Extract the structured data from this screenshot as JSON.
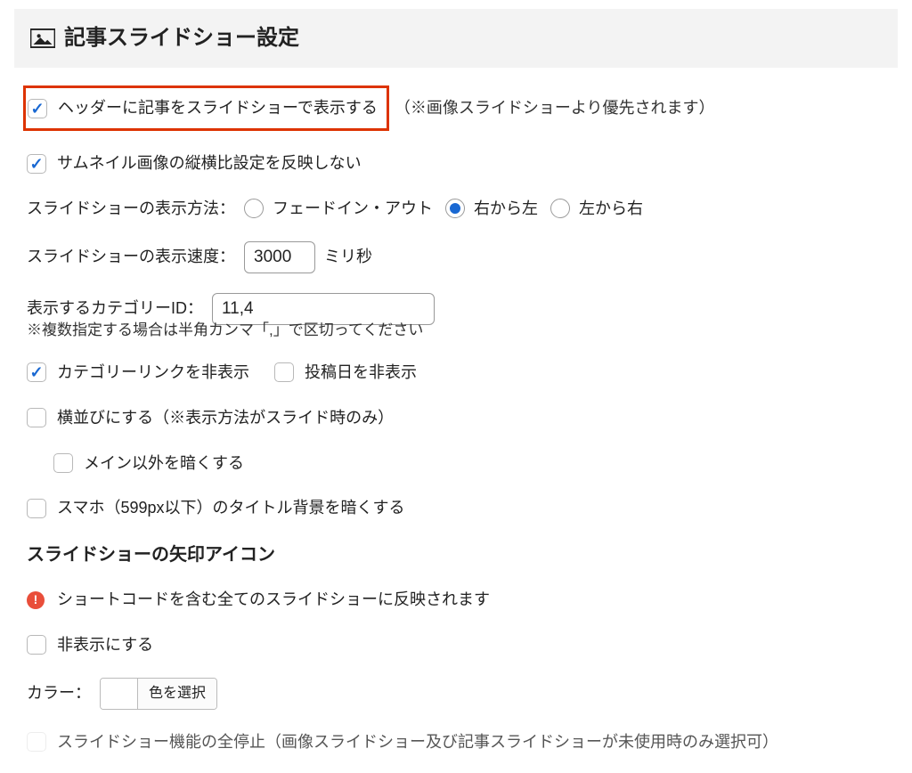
{
  "section_title": "記事スライドショー設定",
  "main_check": {
    "label": "ヘッダーに記事をスライドショーで表示する",
    "note": "（※画像スライドショーより優先されます）",
    "checked": true
  },
  "reflect_aspect": {
    "label": "サムネイル画像の縦横比設定を反映しない",
    "checked": true
  },
  "method": {
    "label": "スライドショーの表示方法：",
    "options": [
      "フェードイン・アウト",
      "右から左",
      "左から右"
    ],
    "selected": 1
  },
  "speed": {
    "label": "スライドショーの表示速度：",
    "value": "3000",
    "unit": "ミリ秒"
  },
  "category_id": {
    "label": "表示するカテゴリーID：",
    "value": "11,4",
    "help": "※複数指定する場合は半角カンマ「,」で区切ってください"
  },
  "hide_category_link": {
    "label": "カテゴリーリンクを非表示",
    "checked": true
  },
  "hide_date": {
    "label": "投稿日を非表示",
    "checked": false
  },
  "horizontal": {
    "label": "横並びにする（※表示方法がスライド時のみ）",
    "checked": false
  },
  "darken_non_main": {
    "label": "メイン以外を暗くする",
    "checked": false
  },
  "darken_sp_title_bg": {
    "label": "スマホ（599px以下）のタイトル背景を暗くする",
    "checked": false
  },
  "arrow_heading": "スライドショーの矢印アイコン",
  "arrow_warn": "ショートコードを含む全てのスライドショーに反映されます",
  "arrow_hide": {
    "label": "非表示にする",
    "checked": false
  },
  "arrow_color": {
    "label": "カラー：",
    "button": "色を選択"
  },
  "stop_all": {
    "label": "スライドショー機能の全停止（画像スライドショー及び記事スライドショーが未使用時のみ選択可）",
    "checked": false
  }
}
